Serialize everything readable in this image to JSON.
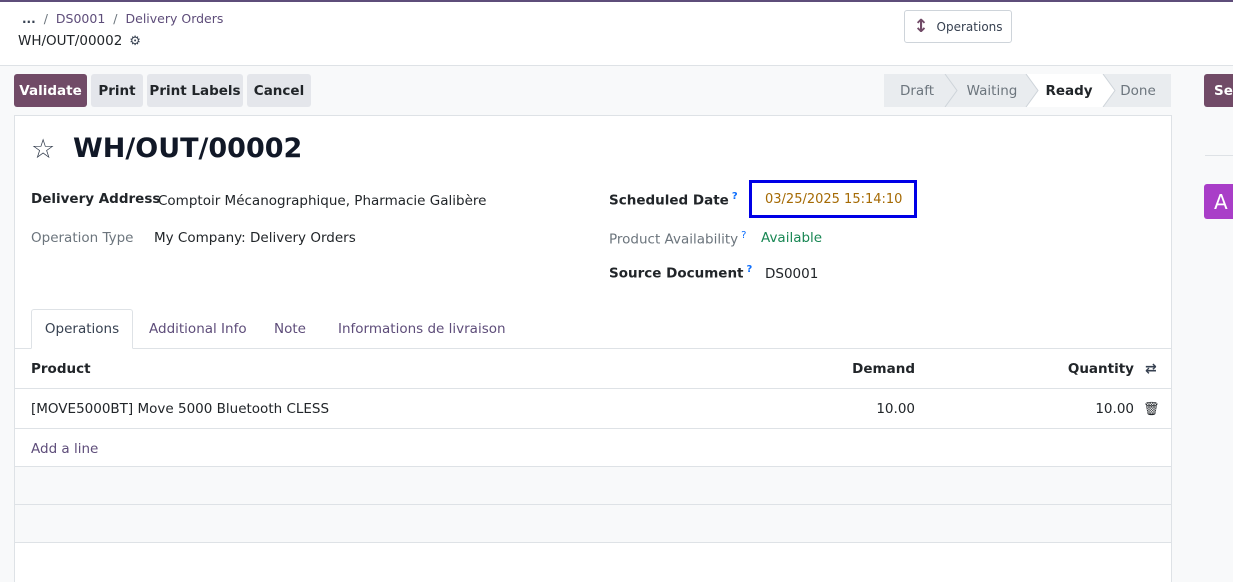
{
  "breadcrumb": {
    "ellipsis": "...",
    "sep": "/",
    "items": [
      "DS0001",
      "Delivery Orders"
    ]
  },
  "record_name": "WH/OUT/00002",
  "operations_button": "Operations",
  "actions": {
    "validate": "Validate",
    "print": "Print",
    "print_labels": "Print Labels",
    "cancel": "Cancel",
    "send": "Sen"
  },
  "statusbar": [
    "Draft",
    "Waiting",
    "Ready",
    "Done"
  ],
  "status_active": "Ready",
  "avatar_letter": "A",
  "form": {
    "title": "WH/OUT/00002",
    "delivery_address_label": "Delivery Address",
    "delivery_address": "Comptoir Mécanographique, Pharmacie Galibère",
    "operation_type_label": "Operation Type",
    "operation_type": "My Company: Delivery Orders",
    "scheduled_date_label": "Scheduled Date",
    "scheduled_date": "03/25/2025 15:14:10",
    "product_availability_label": "Product Availability",
    "product_availability": "Available",
    "source_document_label": "Source Document",
    "source_document": "DS0001",
    "help_mark": "?"
  },
  "tabs": [
    "Operations",
    "Additional Info",
    "Note",
    "Informations de livraison"
  ],
  "table": {
    "headers": {
      "product": "Product",
      "demand": "Demand",
      "quantity": "Quantity"
    },
    "rows": [
      {
        "product": "[MOVE5000BT] Move 5000 Bluetooth CLESS",
        "demand": "10.00",
        "quantity": "10.00"
      }
    ],
    "add_line": "Add a line"
  },
  "colors": {
    "primary": "#714b67",
    "link": "#5e4d7a",
    "highlight_box": "#0000e6",
    "date_text": "#a56a04",
    "available": "#198754",
    "avatar": "#a93ec8"
  },
  "icons": [
    "gear-icon",
    "updown-arrow-icon",
    "star-icon",
    "help-icon",
    "column-options-icon",
    "trash-icon"
  ]
}
